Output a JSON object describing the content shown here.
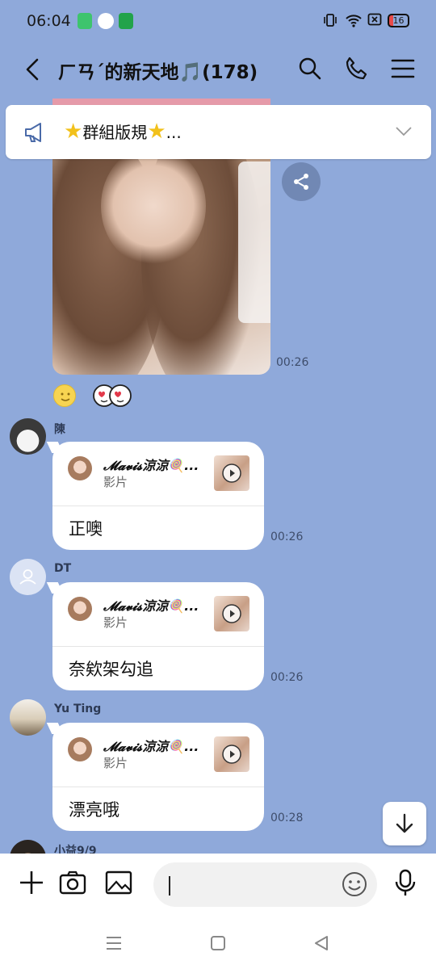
{
  "status_bar": {
    "time": "06:04",
    "battery": "16"
  },
  "header": {
    "title": "ㄏㄢˊ的新天地🎵(178)"
  },
  "announcement": {
    "text": "群組版規",
    "ellipsis": "..."
  },
  "photo_message": {
    "time": "00:26"
  },
  "messages": [
    {
      "sender": "陳",
      "card_title": "𝓜𝓪𝓿𝓲𝓼涼涼🍭...",
      "card_sub": "影片",
      "text": "正噢",
      "time": "00:26"
    },
    {
      "sender": "DT",
      "card_title": "𝓜𝓪𝓿𝓲𝓼涼涼🍭...",
      "card_sub": "影片",
      "text": "奈欸架勾追",
      "time": "00:26"
    },
    {
      "sender": "Yu Ting",
      "card_title": "𝓜𝓪𝓿𝓲𝓼涼涼🍭...",
      "card_sub": "影片",
      "text": "漂亮哦",
      "time": "00:28"
    },
    {
      "sender": "小益9/9"
    }
  ],
  "input": {
    "placeholder": ""
  },
  "colors": {
    "background": "#8FA9DA",
    "bubble": "#FFFFFF",
    "accent": "#F2C11B"
  }
}
